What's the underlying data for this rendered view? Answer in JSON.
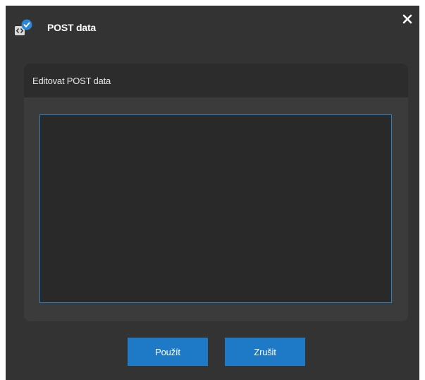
{
  "dialog": {
    "title": "POST data",
    "app_icon": "code-check-icon",
    "close_icon": "close-icon"
  },
  "panel": {
    "title": "Editovat POST data"
  },
  "editor": {
    "value": ""
  },
  "buttons": {
    "apply_label": "Použít",
    "cancel_label": "Zrušit"
  },
  "colors": {
    "background": "#333333",
    "panel": "#3b3b3b",
    "panel_header": "#2c2c2c",
    "editor_background": "#292929",
    "accent": "#1e7ac6",
    "editor_border": "#2a7fc8"
  }
}
